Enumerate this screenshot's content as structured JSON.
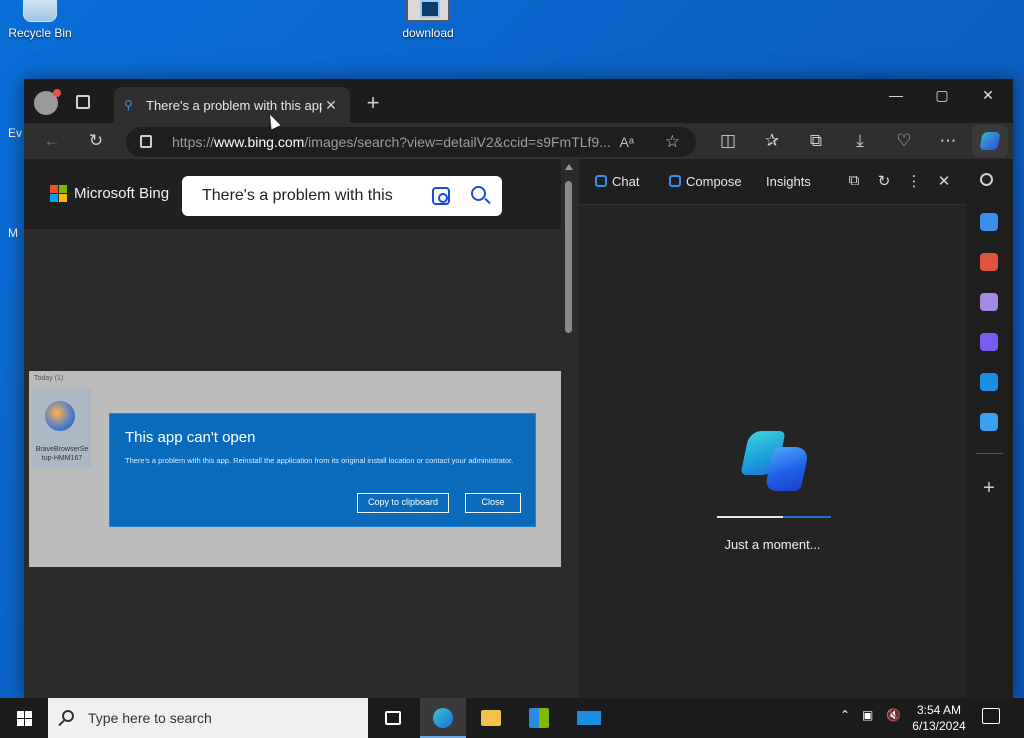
{
  "desktop": {
    "icons": [
      {
        "label": "Recycle Bin"
      },
      {
        "label": "download"
      }
    ],
    "left_snippets": [
      "Ev",
      "M"
    ]
  },
  "browser": {
    "tab": {
      "title": "There's a problem with this app.",
      "favicon": "bing-search-icon"
    },
    "address": {
      "url_prefix": "https://",
      "url_host": "www.bing.com",
      "url_path": "/images/search?view=detailV2&ccid=s9FmTLf9...",
      "read_aloud": "Aᵃ"
    },
    "window_controls": {
      "minimize": "—",
      "maximize": "▢",
      "close": "✕"
    }
  },
  "bing": {
    "brand": "Microsoft Bing",
    "logo_colors": [
      "#f25022",
      "#7fba00",
      "#00a4ef",
      "#ffb900"
    ],
    "search_value": "There's a problem with this"
  },
  "result_image": {
    "folder_label": "Today (1)",
    "file_name": "BraveBrowserSe tup-HMM167",
    "dialog": {
      "title": "This app can't open",
      "message": "There's a problem with this app. Reinstall the application from its original install location or contact your administrator.",
      "copy_button": "Copy to clipboard",
      "close_button": "Close"
    }
  },
  "copilot": {
    "tabs": [
      "Chat",
      "Compose",
      "Insights"
    ],
    "loading_text": "Just a moment...",
    "progress": 0.58
  },
  "rail_icons": [
    {
      "name": "search-icon",
      "color": "#cfcfcf"
    },
    {
      "name": "tag-icon",
      "color": "#3b8eea"
    },
    {
      "name": "toolbox-icon",
      "color": "#e2533f"
    },
    {
      "name": "games-icon",
      "color": "#a58be0"
    },
    {
      "name": "microsoft365-icon",
      "color": "#7b5cf0"
    },
    {
      "name": "outlook-icon",
      "color": "#1a8fe0"
    },
    {
      "name": "send-icon",
      "color": "#3ba0f0"
    }
  ],
  "taskbar": {
    "search_placeholder": "Type here to search",
    "clock_time": "3:54 AM",
    "clock_date": "6/13/2024"
  }
}
